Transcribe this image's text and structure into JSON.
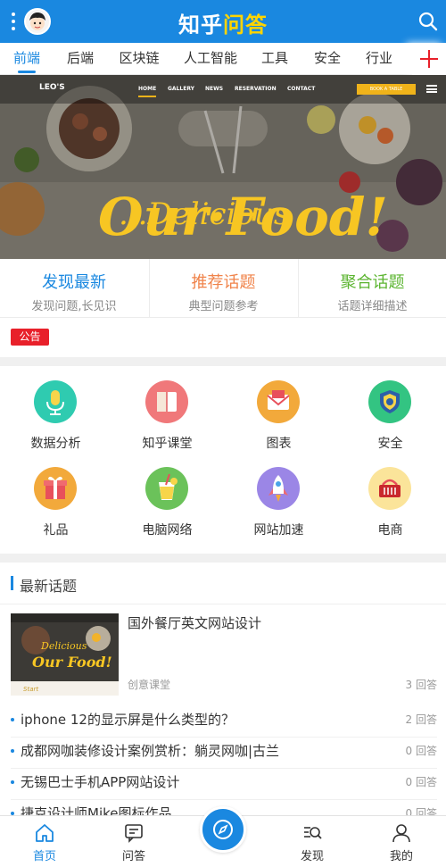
{
  "header": {
    "logo_text": "知乎",
    "logo_highlight": "问答",
    "accent_color": "#1a88e0",
    "menu_icon": "menu-dots-icon",
    "avatar_icon": "avatar-icon",
    "search_icon": "search-icon"
  },
  "tabs": [
    {
      "label": "前端",
      "active": true
    },
    {
      "label": "后端"
    },
    {
      "label": "区块链"
    },
    {
      "label": "人工智能"
    },
    {
      "label": "工具"
    },
    {
      "label": "安全"
    },
    {
      "label": "行业"
    }
  ],
  "tab_add_icon": "plus-icon",
  "banner": {
    "brand": "LEO'S",
    "nav": [
      "HOME",
      "GALLERY",
      "NEWS",
      "RESERVATION",
      "CONTACT"
    ],
    "book_button": "BOOK A TABLE",
    "title_line1": "...Delicious",
    "title_line2": "Our·Food!"
  },
  "features": [
    {
      "title": "发现最新",
      "subtitle": "发现问题,长见识",
      "color": "#1a88e0"
    },
    {
      "title": "推荐话题",
      "subtitle": "典型问题参考",
      "color": "#f0834a"
    },
    {
      "title": "聚合话题",
      "subtitle": "话题详细描述",
      "color": "#5cb531"
    }
  ],
  "notice": {
    "badge": "公告",
    "color": "#e8202a"
  },
  "categories": [
    {
      "label": "数据分析",
      "icon": "microphone-icon",
      "color": "#2fcbb0"
    },
    {
      "label": "知乎课堂",
      "icon": "book-icon",
      "color": "#f0787a"
    },
    {
      "label": "图表",
      "icon": "envelope-icon",
      "color": "#f2a93b"
    },
    {
      "label": "安全",
      "icon": "shield-icon",
      "color": "#33c482"
    },
    {
      "label": "礼品",
      "icon": "gift-icon",
      "color": "#f2a93b"
    },
    {
      "label": "电脑网络",
      "icon": "drink-icon",
      "color": "#6bc25a"
    },
    {
      "label": "网站加速",
      "icon": "rocket-icon",
      "color": "#9b86e6"
    },
    {
      "label": "电商",
      "icon": "basket-icon",
      "color": "#fbe49a"
    }
  ],
  "latest": {
    "title": "最新话题",
    "featured": {
      "title": "国外餐厅英文网站设计",
      "category": "创意课堂",
      "answers": "3 回答",
      "thumb_text": "Delicious Our Food!"
    },
    "items": [
      {
        "title": "iphone 12的显示屏是什么类型的？",
        "answers": "2 回答"
      },
      {
        "title": "成都网咖装修设计案例赏析：躺灵网咖|古兰",
        "answers": "0 回答"
      },
      {
        "title": "无锡巴士手机APP网站设计",
        "answers": "0 回答"
      },
      {
        "title": "捷克设计师Mike图标作品",
        "answers": "0 回答"
      }
    ]
  },
  "bottom_nav": [
    {
      "label": "首页",
      "icon": "home-icon",
      "active": true
    },
    {
      "label": "问答",
      "icon": "chat-icon"
    },
    {
      "label": "",
      "icon": "compass-icon"
    },
    {
      "label": "发现",
      "icon": "discover-icon"
    },
    {
      "label": "我的",
      "icon": "user-icon"
    }
  ]
}
